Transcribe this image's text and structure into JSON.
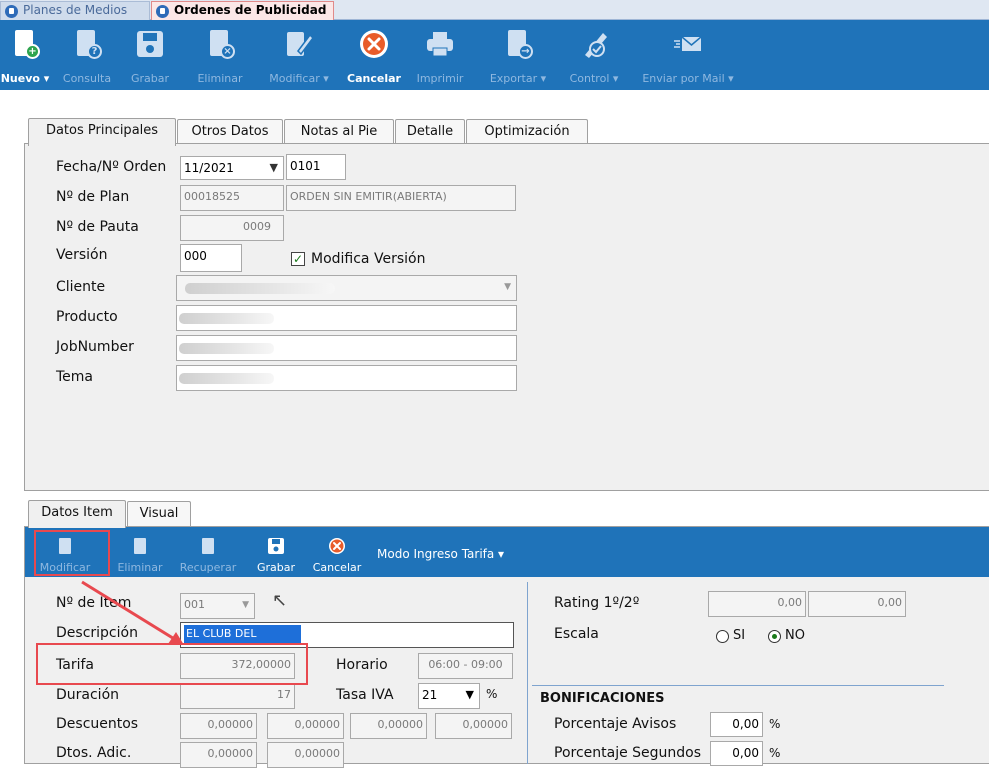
{
  "window_tabs": [
    "Planes de Medios",
    "Ordenes de Publicidad"
  ],
  "toolbar": [
    {
      "label": "Nuevo ▾",
      "icon": "new-document-icon",
      "enabled": true
    },
    {
      "label": "Consulta",
      "icon": "query-icon",
      "enabled": false
    },
    {
      "label": "Grabar",
      "icon": "save-icon",
      "enabled": false
    },
    {
      "label": "Eliminar",
      "icon": "delete-icon",
      "enabled": false
    },
    {
      "label": "Modificar ▾",
      "icon": "edit-icon",
      "enabled": false
    },
    {
      "label": "Cancelar",
      "icon": "cancel-icon",
      "enabled": true
    },
    {
      "label": "Imprimir",
      "icon": "printer-icon",
      "enabled": false
    },
    {
      "label": "Exportar ▾",
      "icon": "export-icon",
      "enabled": false
    },
    {
      "label": "Control ▾",
      "icon": "control-icon",
      "enabled": false
    },
    {
      "label": "Enviar por Mail ▾",
      "icon": "mail-icon",
      "enabled": false
    }
  ],
  "tabs": [
    "Datos Principales",
    "Otros Datos",
    "Notas al Pie",
    "Detalle",
    "Optimización"
  ],
  "main": {
    "fecha_label": "Fecha/Nº Orden",
    "fecha_value": "11/2021",
    "orden_value": "0101",
    "plan_label": "Nº de Plan",
    "plan_value": "00018525",
    "plan_status": "ORDEN SIN EMITIR(ABIERTA)",
    "pauta_label": "Nº de Pauta",
    "pauta_value": "0009",
    "version_label": "Versión",
    "version_value": "000",
    "modifica_version_label": "Modifica Versión",
    "modifica_version_checked": true,
    "cliente_label": "Cliente",
    "producto_label": "Producto",
    "jobnumber_label": "JobNumber",
    "tema_label": "Tema"
  },
  "item_tabs": [
    "Datos Item",
    "Visual"
  ],
  "item_toolbar": [
    {
      "label": "Modificar",
      "icon": "edit-icon",
      "enabled": false
    },
    {
      "label": "Eliminar",
      "icon": "delete-icon",
      "enabled": false
    },
    {
      "label": "Recuperar",
      "icon": "recover-icon",
      "enabled": false
    },
    {
      "label": "Grabar",
      "icon": "save-icon",
      "enabled": true
    },
    {
      "label": "Cancelar",
      "icon": "cancel-icon",
      "enabled": true
    }
  ],
  "modo_ingreso": "Modo Ingreso Tarifa ▾",
  "item": {
    "item_label": "Nº de Item",
    "item_value": "001",
    "descripcion_label": "Descripción",
    "descripcion_value": "EL CLUB DEL",
    "tarifa_label": "Tarifa",
    "tarifa_value": "372,00000",
    "horario_label": "Horario",
    "horario_value": "06:00 - 09:00",
    "duracion_label": "Duración",
    "duracion_value": "17",
    "tasa_iva_label": "Tasa IVA",
    "tasa_iva_value": "21",
    "tasa_iva_unit": "%",
    "descuentos_label": "Descuentos",
    "descuentos": [
      "0,00000",
      "0,00000",
      "0,00000",
      "0,00000"
    ],
    "dtos_adic_label": "Dtos. Adic.",
    "dtos_adic": [
      "0,00000",
      "0,00000"
    ]
  },
  "right": {
    "rating_label": "Rating 1º/2º",
    "rating": [
      "0,00",
      "0,00"
    ],
    "escala_label": "Escala",
    "escala_si": "SI",
    "escala_no": "NO",
    "escala_selected": "NO",
    "bonificaciones_title": "BONIFICACIONES",
    "porc_avisos_label": "Porcentaje Avisos",
    "porc_avisos_value": "0,00",
    "porc_avisos_unit": "%",
    "porc_segundos_label": "Porcentaje Segundos",
    "porc_segundos_value": "0,00",
    "porc_segundos_unit": "%"
  },
  "colors": {
    "toolbar_blue": "#1f73b9",
    "highlight_red": "#e8494f",
    "selection_blue": "#1e6fd9"
  }
}
